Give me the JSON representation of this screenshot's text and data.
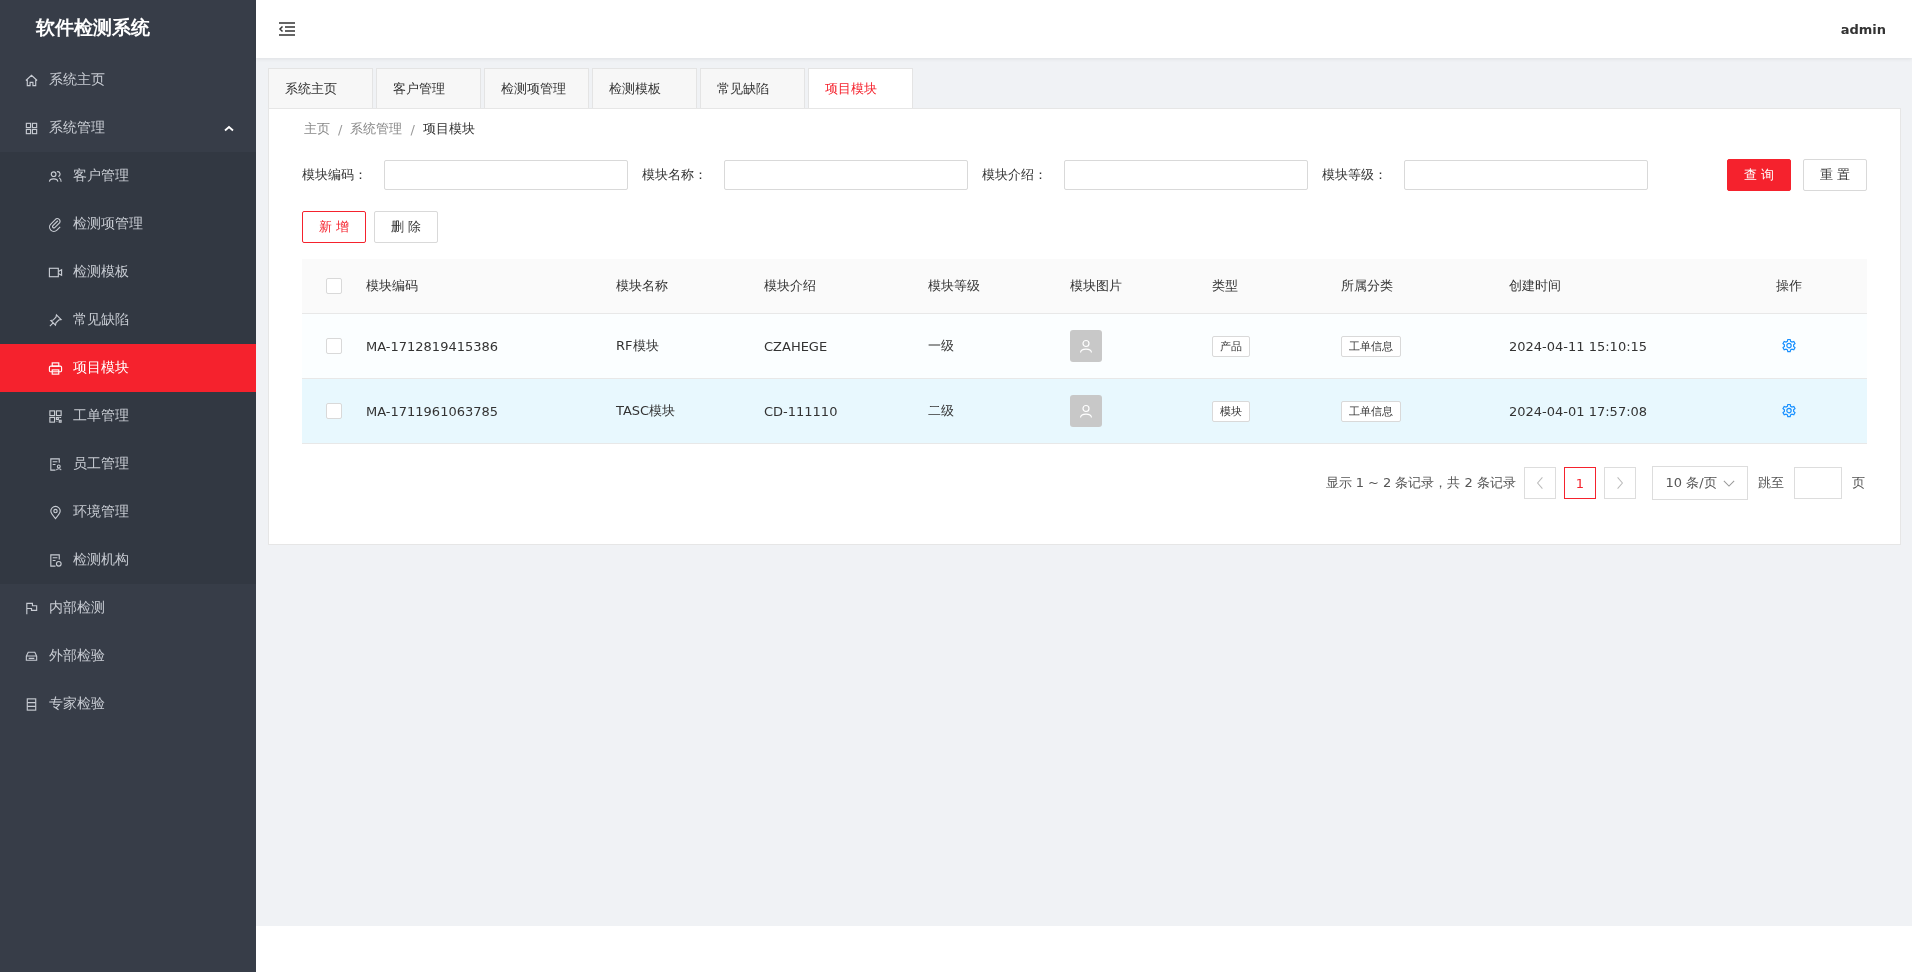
{
  "sidebar": {
    "title": "软件检测系统",
    "items": [
      {
        "label": "系统主页",
        "selected": false
      },
      {
        "label": "系统管理",
        "selected": false,
        "expanded": true,
        "children": [
          {
            "label": "客户管理",
            "selected": false
          },
          {
            "label": "检测项管理",
            "selected": false
          },
          {
            "label": "检测模板",
            "selected": false
          },
          {
            "label": "常见缺陷",
            "selected": false
          },
          {
            "label": "项目模块",
            "selected": true
          },
          {
            "label": "工单管理",
            "selected": false
          },
          {
            "label": "员工管理",
            "selected": false
          },
          {
            "label": "环境管理",
            "selected": false
          },
          {
            "label": "检测机构",
            "selected": false
          }
        ]
      },
      {
        "label": "内部检测",
        "selected": false
      },
      {
        "label": "外部检验",
        "selected": false
      },
      {
        "label": "专家检验",
        "selected": false
      }
    ]
  },
  "header": {
    "user": "admin"
  },
  "tabs": [
    {
      "label": "系统主页",
      "selected": false
    },
    {
      "label": "客户管理",
      "selected": false
    },
    {
      "label": "检测项管理",
      "selected": false
    },
    {
      "label": "检测模板",
      "selected": false
    },
    {
      "label": "常见缺陷",
      "selected": false
    },
    {
      "label": "项目模块",
      "selected": true
    }
  ],
  "breadcrumb": [
    "主页",
    "系统管理",
    "项目模块"
  ],
  "breadcrumb_separator": "/",
  "filters": [
    {
      "label": "模块编码："
    },
    {
      "label": "模块名称："
    },
    {
      "label": "模块介绍："
    },
    {
      "label": "模块等级："
    }
  ],
  "search_buttons": {
    "query": "查 询",
    "reset": "重 置"
  },
  "actions": {
    "add": "新 增",
    "delete": "删 除"
  },
  "table": {
    "all_checked": false,
    "columns": [
      "模块编码",
      "模块名称",
      "模块介绍",
      "模块等级",
      "模块图片",
      "类型",
      "所属分类",
      "创建时间",
      "操作"
    ],
    "rows": [
      {
        "checked": false,
        "selected": false,
        "code": "MA-1712819415386",
        "name": "RF模块",
        "intro": "CZAHEGE",
        "level": "一级",
        "type": "产品",
        "category": "工单信息",
        "created": "2024-04-11 15:10:15"
      },
      {
        "checked": false,
        "selected": true,
        "code": "MA-1711961063785",
        "name": "TASC模块",
        "intro": "CD-111110",
        "level": "二级",
        "type": "模块",
        "category": "工单信息",
        "created": "2024-04-01 17:57:08"
      }
    ]
  },
  "pagination": {
    "summary": "显示 1 ~ 2 条记录，共 2 条记录",
    "pages": [
      {
        "label": "1",
        "selected": true
      }
    ],
    "page_size": "10 条/页",
    "jump_label": "跳至",
    "page_unit": "页"
  }
}
